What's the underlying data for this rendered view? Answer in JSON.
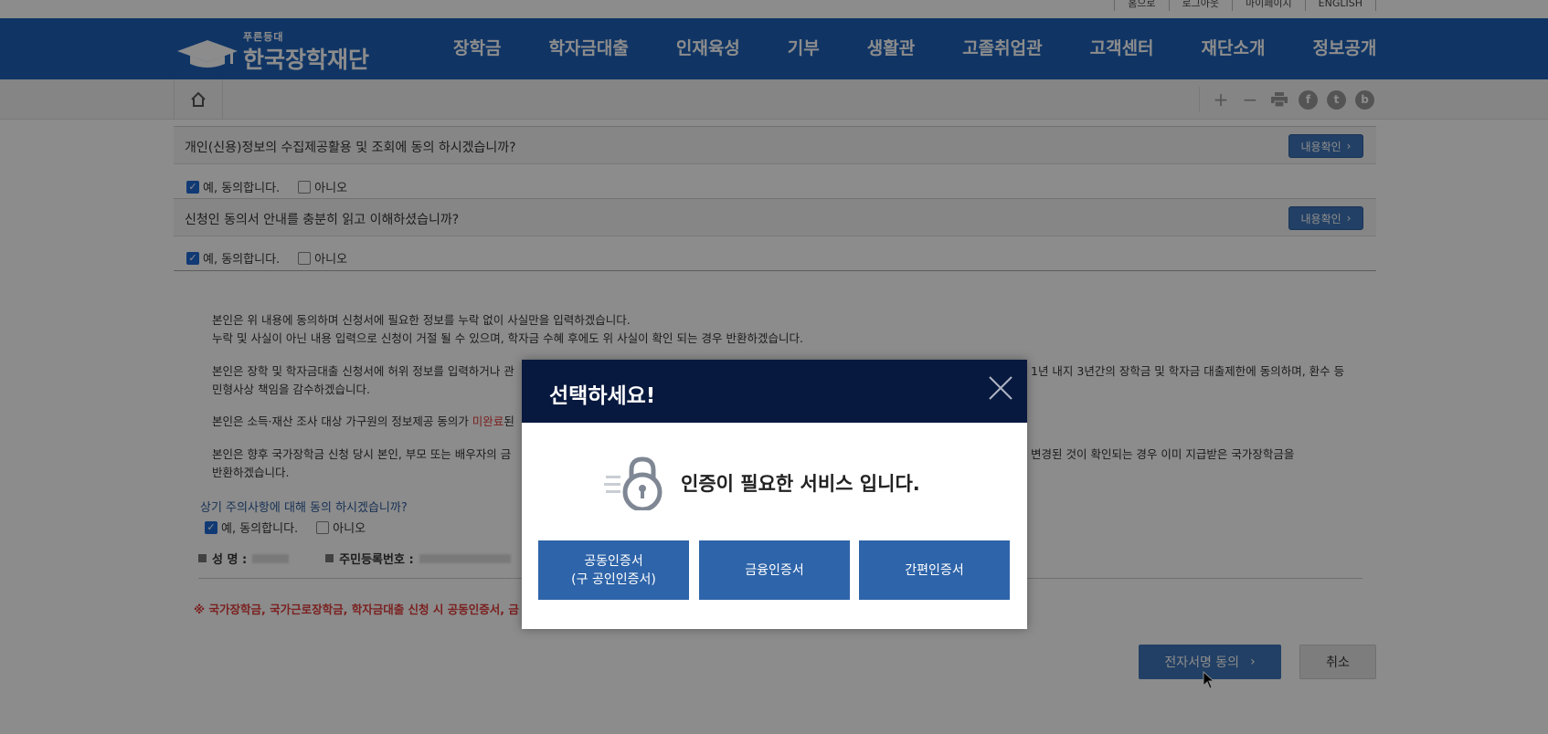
{
  "util": {
    "links": [
      "홈으로",
      "로그아웃",
      "마이페이지",
      "ENGLISH"
    ]
  },
  "header": {
    "logo_tag": "푸른등대",
    "logo_name": "한국장학재단",
    "nav": [
      "장학금",
      "학자금대출",
      "인재육성",
      "기부",
      "생활관",
      "고졸취업관",
      "고객센터",
      "재단소개",
      "정보공개"
    ]
  },
  "subbar": {
    "tools": [
      "plus-icon",
      "minus-icon",
      "print-icon",
      "facebook-icon",
      "twitter-icon",
      "blog-icon"
    ]
  },
  "consents": [
    {
      "question": "개인(신용)정보의 수집제공활용 및 조회에 동의 하시겠습니까?",
      "detail_label": "내용확인",
      "yes": "예, 동의합니다.",
      "no": "아니오"
    },
    {
      "question": "신청인 동의서 안내를 충분히 읽고 이해하셨습니까?",
      "detail_label": "내용확인",
      "yes": "예, 동의합니다.",
      "no": "아니오"
    }
  ],
  "notices": {
    "n1_l1": "본인은 위 내용에 동의하며 신청서에 필요한 정보를 누락 없이 사실만을 입력하겠습니다.",
    "n1_l2": "누락 및 사실이 아닌 내용 입력으로 신청이 거절 될 수 있으며, 학자금 수혜 후에도 위 사실이 확인 되는 경우 반환하겠습니다.",
    "n2_l1a": "본인은 장학 및 학자금대출 신청서에 허위 정보를 입력하거나 관",
    "n2_l1b": "1년 내지 3년간의 장학금 및 학자금 대출제한에 동의하며, 환수 등",
    "n2_l2": "민형사상 책임을 감수하겠습니다.",
    "n3_a": "본인은 소득·재산 조사 대상 가구원의 정보제공 동의가 ",
    "n3_red": "미완료",
    "n3_b": "된",
    "n4_l1a": "본인은 향후 국가장학금 신청 당시 본인, 부모 또는 배우자의 금",
    "n4_l1b": "변경된 것이 확인되는 경우 이미 지급받은 국가장학금을",
    "n4_l2": "반환하겠습니다."
  },
  "caution": {
    "question": "상기 주의사항에 대해 동의 하시겠습니까?",
    "yes": "예, 동의합니다.",
    "no": "아니오"
  },
  "identity": {
    "name_label": "성 명 :",
    "rrn_label": "주민등록번호 :"
  },
  "warning": "※ 국가장학금, 국가근로장학금, 학자금대출 신청 시 공동인증서, 금",
  "buttons": {
    "sign": "전자서명 동의",
    "cancel": "취소"
  },
  "modal": {
    "title": "선택하세요!",
    "message": "인증이 필요한 서비스 입니다.",
    "options": [
      {
        "line1": "공동인증서",
        "line2": "(구 공인인증서)"
      },
      {
        "line1": "금융인증서",
        "line2": ""
      },
      {
        "line1": "간편인증서",
        "line2": ""
      }
    ]
  },
  "colors": {
    "header_bg": "#1e62b9",
    "modal_head": "#08193f",
    "button_blue": "#2e64a9",
    "warning_red": "#e03b3b"
  }
}
